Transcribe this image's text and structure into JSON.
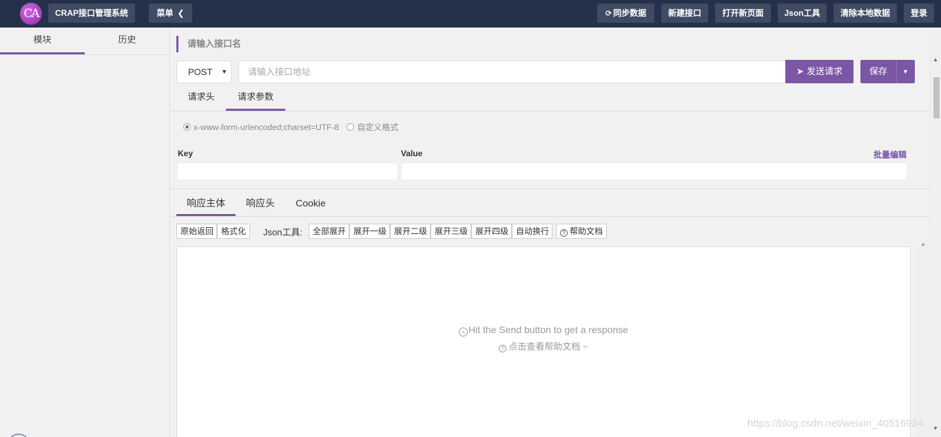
{
  "app": {
    "logo_text": "CA",
    "title": "CRAP接口管理系统",
    "menu_label": "菜单"
  },
  "topnav": {
    "sync": "同步数据",
    "new_api": "新建接口",
    "open_page": "打开新页面",
    "json_tool": "Json工具",
    "clear_local": "清除本地数据",
    "login": "登录"
  },
  "sidebar": {
    "tabs": [
      {
        "label": "模块",
        "active": true
      },
      {
        "label": "历史",
        "active": false
      }
    ]
  },
  "request": {
    "name_placeholder": "请输入接口名",
    "method": "POST",
    "url_placeholder": "请输入接口地址",
    "send_label": "发送请求",
    "save_label": "保存",
    "tabs": [
      {
        "label": "请求头",
        "active": false
      },
      {
        "label": "请求参数",
        "active": true
      }
    ],
    "content_types": [
      {
        "label": "x-www-form-urlencoded;charset=UTF-8",
        "checked": true
      },
      {
        "label": "自定义格式",
        "checked": false
      }
    ],
    "params": {
      "key_header": "Key",
      "value_header": "Value",
      "batch_edit": "批量编辑"
    }
  },
  "response": {
    "tabs": [
      {
        "label": "响应主体",
        "active": true
      },
      {
        "label": "响应头",
        "active": false
      },
      {
        "label": "Cookie",
        "active": false
      }
    ],
    "view_buttons": [
      "原始返回",
      "格式化"
    ],
    "json_tool_label": "Json工具:",
    "json_buttons": [
      "全部展开",
      "展开一级",
      "展开二级",
      "展开三级",
      "展开四级",
      "自动换行"
    ],
    "help_doc": "帮助文档",
    "empty_message": "Hit the Send button to get a response",
    "help_hint": "点击查看帮助文档 ~"
  },
  "watermark": "https://blog.csdn.net/weixin_40516924",
  "colors": {
    "accent": "#7a56a5",
    "topbar": "#25304a",
    "topbar_button": "#3f4b62"
  }
}
